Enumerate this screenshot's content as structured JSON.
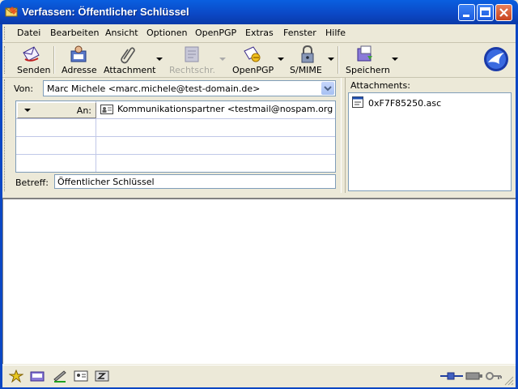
{
  "window": {
    "title": "Verfassen: Öffentlicher Schlüssel"
  },
  "menu": [
    {
      "label": "Datei"
    },
    {
      "label": "Bearbeiten"
    },
    {
      "label": "Ansicht"
    },
    {
      "label": "Optionen"
    },
    {
      "label": "OpenPGP"
    },
    {
      "label": "Extras"
    },
    {
      "label": "Fenster"
    },
    {
      "label": "Hilfe"
    }
  ],
  "toolbar": {
    "senden": "Senden",
    "adresse": "Adresse",
    "attachment": "Attachment",
    "rechtschr": "Rechtschr.",
    "openpgp": "OpenPGP",
    "smime": "S/MIME",
    "speichern": "Speichern"
  },
  "header": {
    "from_label": "Von:",
    "from_value": "Marc Michele <marc.michele@test-domain.de>",
    "recipient_type": "An:",
    "recipient_value": "Kommunikationspartner <testmail@nospam.org",
    "subject_label": "Betreff:",
    "subject_value": "Öffentlicher Schlüssel"
  },
  "attachments": {
    "label": "Attachments:",
    "items": [
      {
        "name": "0xF7F85250.asc"
      }
    ]
  }
}
